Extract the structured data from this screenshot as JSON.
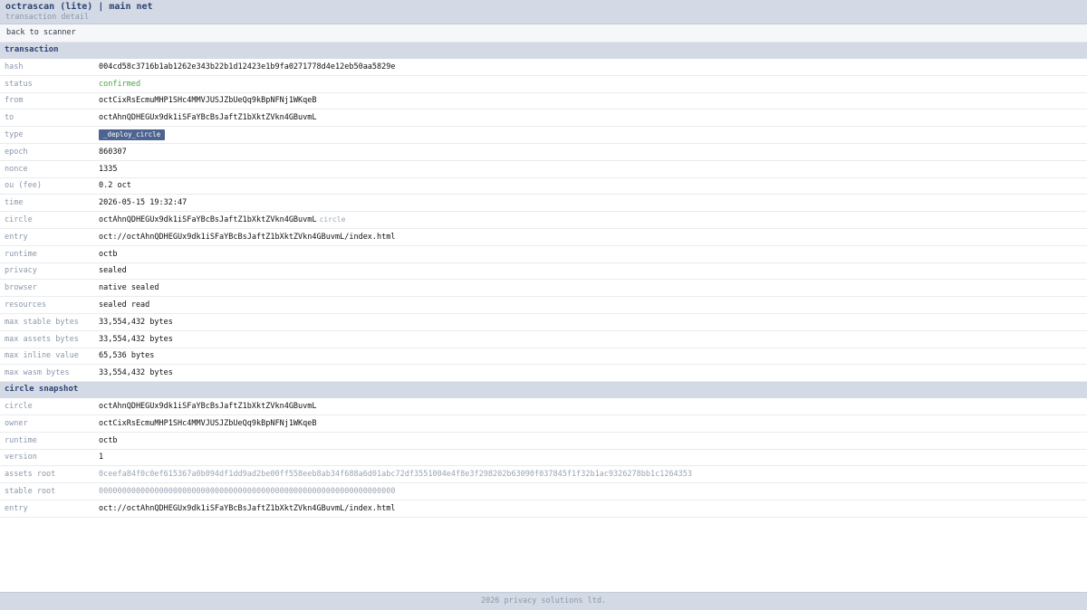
{
  "header": {
    "title": "octrascan (lite) | main net",
    "subtitle": "transaction detail"
  },
  "nav": {
    "back_label": "back to scanner"
  },
  "transaction": {
    "section_title": "transaction",
    "rows": [
      {
        "label": "hash",
        "value": "004cd58c3716b1ab1262e343b22b1d12423e1b9fa0271778d4e12eb50aa5829e"
      },
      {
        "label": "status",
        "value": "confirmed",
        "style": "green"
      },
      {
        "label": "from",
        "value": "octCixRsEcmuMHP1SHc4MMVJUSJZbUeQq9kBpNFNj1WKqeB"
      },
      {
        "label": "to",
        "value": "octAhnQDHEGUx9dk1iSFaYBcBsJaftZ1bXktZVkn4GBuvmL"
      },
      {
        "label": "type",
        "value": "_deploy_circle",
        "style": "badge"
      },
      {
        "label": "epoch",
        "value": "860307"
      },
      {
        "label": "nonce",
        "value": "1335"
      },
      {
        "label": "ou (fee)",
        "value": "0.2 oct"
      },
      {
        "label": "time",
        "value": "2026-05-15 19:32:47"
      },
      {
        "label": "circle",
        "value": "octAhnQDHEGUx9dk1iSFaYBcBsJaftZ1bXktZVkn4GBuvmL",
        "suffix": "circle"
      },
      {
        "label": "entry",
        "value": "oct://octAhnQDHEGUx9dk1iSFaYBcBsJaftZ1bXktZVkn4GBuvmL/index.html"
      },
      {
        "label": "runtime",
        "value": "octb"
      },
      {
        "label": "privacy",
        "value": "sealed"
      },
      {
        "label": "browser",
        "value": "native sealed"
      },
      {
        "label": "resources",
        "value": "sealed read"
      },
      {
        "label": "max stable bytes",
        "value": "33,554,432 bytes"
      },
      {
        "label": "max assets bytes",
        "value": "33,554,432 bytes"
      },
      {
        "label": "max inline value",
        "value": "65,536 bytes"
      },
      {
        "label": "max wasm bytes",
        "value": "33,554,432 bytes"
      }
    ]
  },
  "circle_snapshot": {
    "section_title": "circle snapshot",
    "rows": [
      {
        "label": "circle",
        "value": "octAhnQDHEGUx9dk1iSFaYBcBsJaftZ1bXktZVkn4GBuvmL"
      },
      {
        "label": "owner",
        "value": "octCixRsEcmuMHP1SHc4MMVJUSJZbUeQq9kBpNFNj1WKqeB"
      },
      {
        "label": "runtime",
        "value": "octb"
      },
      {
        "label": "version",
        "value": "1"
      },
      {
        "label": "assets root",
        "value": "0ceefa84f0c0ef615367a0b094df1dd9ad2be00ff558eeb8ab34f688a6d01abc72df3551004e4f8e3f298202b63090f037845f1f32b1ac9326278bb1c1264353",
        "style": "muted"
      },
      {
        "label": "stable root",
        "value": "0000000000000000000000000000000000000000000000000000000000000000",
        "style": "muted"
      },
      {
        "label": "entry",
        "value": "oct://octAhnQDHEGUx9dk1iSFaYBcBsJaftZ1bXktZVkn4GBuvmL/index.html"
      }
    ]
  },
  "footer": {
    "text": "2026 privacy solutions ltd."
  },
  "colors": {
    "header_bg": "#d3dae5",
    "accent": "#2d4372",
    "badge_bg": "#4d6490",
    "status_green": "#4aa44a"
  }
}
